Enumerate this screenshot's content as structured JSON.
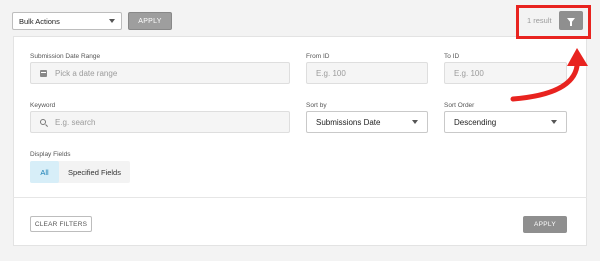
{
  "toolbar": {
    "bulk_actions": "Bulk Actions",
    "apply_label": "APPLY",
    "result_count": "1 result",
    "filter_icon": "filter-icon"
  },
  "annotation": {
    "color": "#e8231f"
  },
  "filters": {
    "date_range": {
      "label": "Submission Date Range",
      "placeholder": "Pick a date range",
      "icon": "calendar-icon"
    },
    "from_id": {
      "label": "From ID",
      "placeholder": "E.g. 100"
    },
    "to_id": {
      "label": "To ID",
      "placeholder": "E.g. 100"
    },
    "keyword": {
      "label": "Keyword",
      "placeholder": "E.g. search",
      "icon": "search-icon"
    },
    "sort_by": {
      "label": "Sort by",
      "value": "Submissions Date"
    },
    "sort_order": {
      "label": "Sort Order",
      "value": "Descending"
    },
    "display_fields": {
      "label": "Display Fields",
      "options": [
        "All",
        "Specified Fields"
      ],
      "selected": "All"
    }
  },
  "footer": {
    "clear_label": "CLEAR FILTERS",
    "apply_label": "APPLY"
  }
}
